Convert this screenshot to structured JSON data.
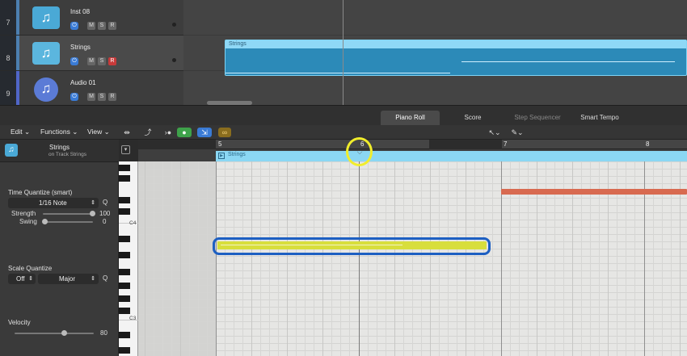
{
  "tracks": [
    {
      "num": "7",
      "name": "Inst 08",
      "icon": "music-note-icon"
    },
    {
      "num": "8",
      "name": "Strings",
      "icon": "music-note-icon"
    },
    {
      "num": "9",
      "name": "Audio 01",
      "icon": "audio-icon"
    }
  ],
  "track_buttons": {
    "power": "⏻",
    "mute": "M",
    "solo": "S",
    "record": "R"
  },
  "region_top": {
    "label": "Strings"
  },
  "tabs": {
    "piano_roll": "Piano Roll",
    "score": "Score",
    "step_sequencer": "Step Sequencer",
    "smart_tempo": "Smart Tempo"
  },
  "toolbar": {
    "edit": "Edit",
    "functions": "Functions",
    "view": "View"
  },
  "inspector": {
    "region_name": "Strings",
    "region_sub": "on Track Strings",
    "time_quantize_label": "Time Quantize (smart)",
    "time_quantize_value": "1/16 Note",
    "q_label": "Q",
    "strength_label": "Strength",
    "strength_value": "100",
    "swing_label": "Swing",
    "swing_value": "0",
    "scale_quantize_label": "Scale Quantize",
    "scale_off": "Off",
    "scale_major": "Major",
    "velocity_label": "Velocity",
    "velocity_value": "80"
  },
  "ruler": {
    "bars": [
      "5",
      "6",
      "7",
      "8"
    ]
  },
  "roll_region": {
    "label": "Strings"
  },
  "keyboard": {
    "c4": "C4",
    "c3": "C3"
  },
  "colors": {
    "accent_blue": "#3a7bd5",
    "region_blue": "#2c8ab8",
    "selected_note": "#d8de3c",
    "other_note": "#d86a50",
    "highlight_ring_blue": "#1d5fc2",
    "highlight_ring_yellow": "#f1ed2b"
  }
}
